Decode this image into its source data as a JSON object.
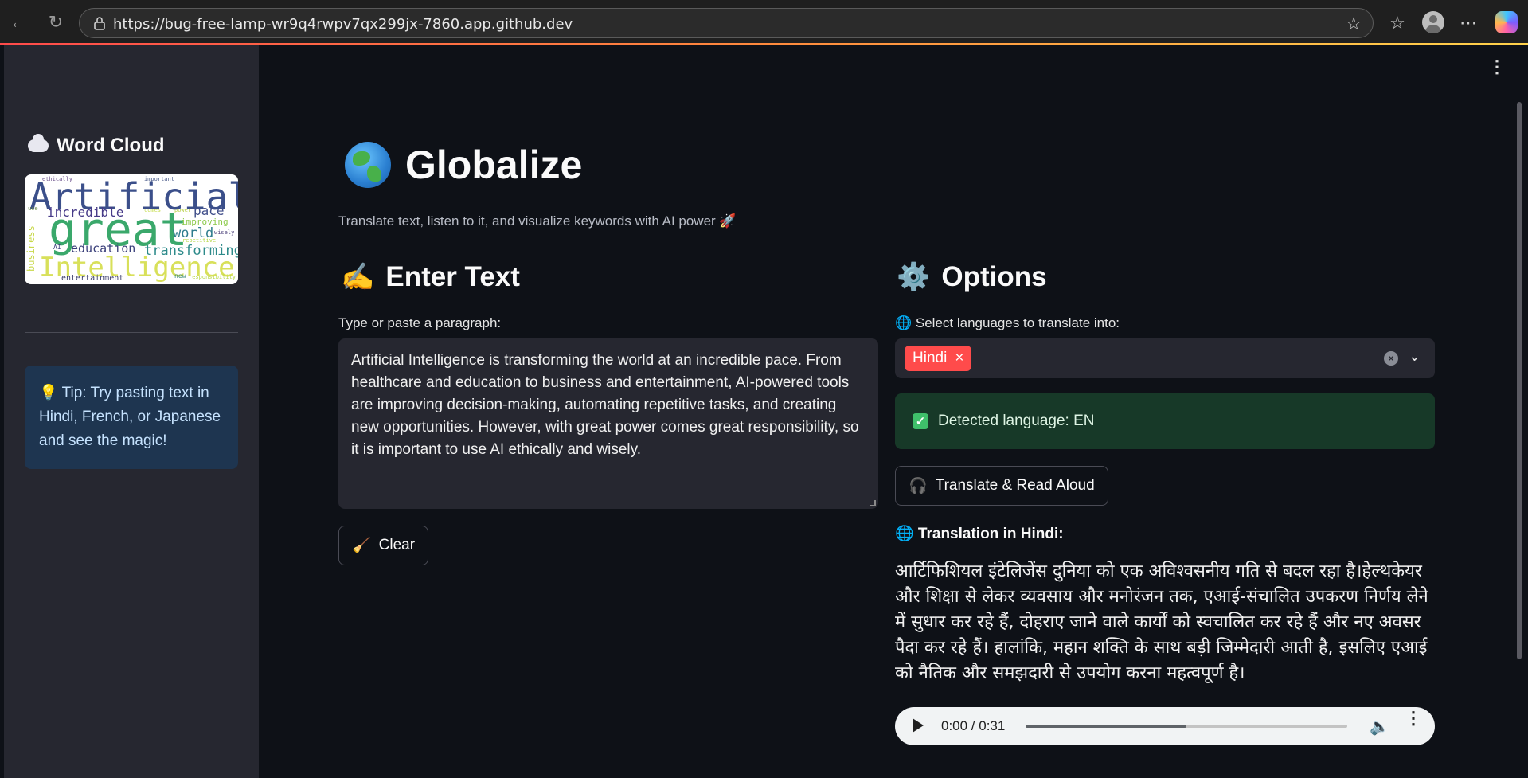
{
  "browser": {
    "url": "https://bug-free-lamp-wr9q4rwpv7qx299jx-7860.app.github.dev",
    "back_icon": "arrow-left-icon",
    "reload_icon": "reload-icon"
  },
  "sidebar": {
    "title": "Word Cloud",
    "wordcloud_words": [
      "Artificial",
      "great",
      "Intelligence",
      "incredible",
      "pace",
      "world",
      "education",
      "transforming",
      "improving",
      "business",
      "entertainment",
      "ethically",
      "important",
      "wisely",
      "repetitive",
      "comes",
      "power",
      "AI",
      "new",
      "responsibility",
      "use"
    ],
    "tip": "💡 Tip: Try pasting text in Hindi, French, or Japanese and see the magic!"
  },
  "main": {
    "title": "Globalize",
    "subtitle": "Translate text, listen to it, and visualize keywords with AI power 🚀",
    "enter_text": {
      "heading": "Enter Text",
      "heading_emoji": "✍️",
      "label": "Type or paste a paragraph:",
      "value": "Artificial Intelligence is transforming the world at an incredible pace. From healthcare and education to business and entertainment, AI-powered tools are improving decision-making, automating repetitive tasks, and creating new opportunities. However, with great power comes great responsibility, so it is important to use AI ethically and wisely.",
      "clear_button": "Clear",
      "clear_emoji": "🧹"
    },
    "options": {
      "heading": "Options",
      "heading_emoji": "⚙️",
      "languages_label": "🌐 Select languages to translate into:",
      "selected_languages": [
        "Hindi"
      ],
      "detected_language": "Detected language: EN",
      "translate_button": "Translate & Read Aloud",
      "translate_emoji": "🎧",
      "translation_title": "🌐 Translation in Hindi:",
      "translation_text": "आर्टिफिशियल इंटेलिजेंस दुनिया को एक अविश्वसनीय गति से बदल रहा है।हेल्थकेयर और शिक्षा से लेकर व्यवसाय और मनोरंजन तक, एआई-संचालित उपकरण निर्णय लेने में सुधार कर रहे हैं, दोहराए जाने वाले कार्यों को स्वचालित कर रहे हैं और नए अवसर पैदा कर रहे हैं। हालांकि, महान शक्ति के साथ बड़ी जिम्मेदारी आती है, इसलिए एआई को नैतिक और समझदारी से उपयोग करना महत्वपूर्ण है।",
      "audio": {
        "time": "0:00 / 0:31",
        "progress": 0.5
      }
    }
  },
  "colors": {
    "accent": "#ff4b4b",
    "sidebar_bg": "#262730",
    "main_bg": "#0e1117",
    "success_bg": "#173928",
    "tip_bg": "#1e3550"
  }
}
